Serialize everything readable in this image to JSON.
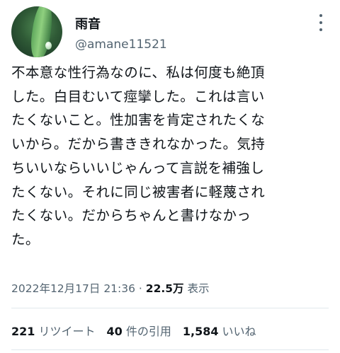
{
  "user": {
    "display_name": "雨音",
    "handle": "@amane11521",
    "avatar_icon": "leaf-avatar"
  },
  "more_icon": "more-vertical-icon",
  "tweet": {
    "lines": [
      "不本意な性行為なのに、私は何度も絶頂",
      "した。白目むいて痙攣した。これは言い",
      "たくないこと。性加害を肯定されたくな",
      "いから。だから書ききれなかった。気持",
      "ちいいならいいじゃんって言説を補強し",
      "たくない。それに同じ被害者に軽蔑され",
      "たくない。だからちゃんと書けなかっ",
      "た。"
    ]
  },
  "meta": {
    "timestamp": "2022年12月17日 21:36",
    "separator": " · ",
    "views_count": "22.5万",
    "views_label": " 表示"
  },
  "stats": {
    "retweets_count": "221",
    "retweets_label": " リツイート",
    "quotes_count": "40",
    "quotes_label": " 件の引用",
    "likes_count": "1,584",
    "likes_label": " いいね"
  },
  "colors": {
    "text_primary": "#0f1419",
    "text_secondary": "#536471",
    "divider": "#e1e8ed"
  }
}
